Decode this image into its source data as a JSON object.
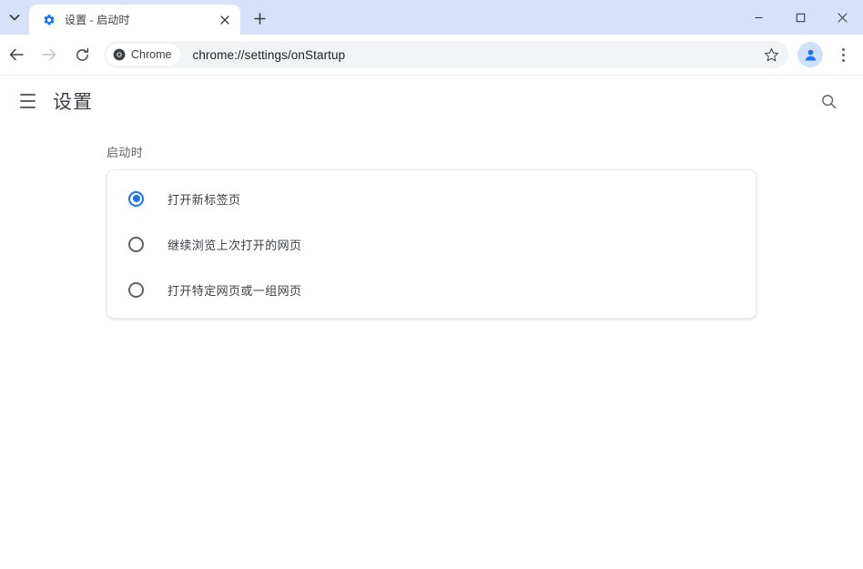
{
  "window": {
    "tab_search_icon": "chevron-down-icon",
    "minimize_label": "─",
    "maximize_label": "□",
    "close_label": "✕",
    "titlebar_color": "#d6e2f7"
  },
  "tab": {
    "favicon": "gear-icon",
    "title": "设置 - 启动时",
    "close_label": "✕",
    "new_tab_label": "+"
  },
  "toolbar": {
    "back_icon": "arrow-left-icon",
    "forward_icon": "arrow-right-icon",
    "reload_icon": "reload-icon",
    "chip_icon": "chrome-logo-icon",
    "chip_label": "Chrome",
    "url": "chrome://settings/onStartup",
    "star_icon": "star-icon",
    "profile_icon": "person-icon",
    "menu_icon": "more-vertical-icon"
  },
  "settings": {
    "menu_icon": "hamburger-menu-icon",
    "title": "设置",
    "search_icon": "search-icon",
    "section_heading": "启动时",
    "accent_color": "#1a73e8",
    "options": [
      {
        "label": "打开新标签页",
        "selected": true
      },
      {
        "label": "继续浏览上次打开的网页",
        "selected": false
      },
      {
        "label": "打开特定网页或一组网页",
        "selected": false
      }
    ]
  }
}
